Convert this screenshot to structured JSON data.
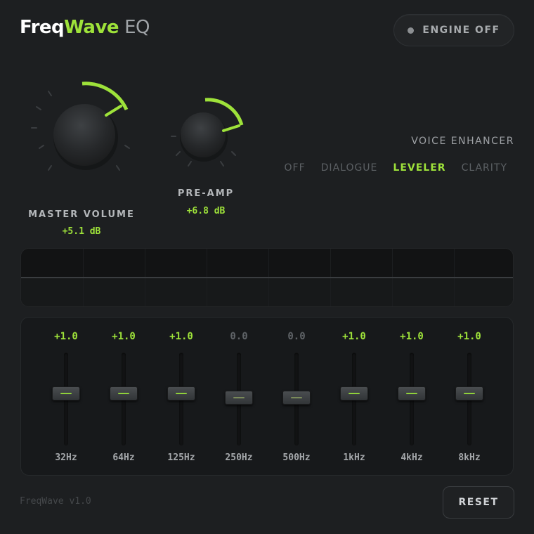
{
  "header": {
    "brand_part1": "Freq",
    "brand_part2": "Wave",
    "brand_suffix": "EQ",
    "engine_button": "ENGINE OFF",
    "engine_status_color": "#8c8f92"
  },
  "knobs": {
    "master": {
      "label": "MASTER VOLUME",
      "value": "+5.1 dB"
    },
    "preamp": {
      "label": "PRE-AMP",
      "value": "+6.8 dB"
    }
  },
  "voice_enhancer": {
    "title": "VOICE ENHANCER",
    "options": [
      "OFF",
      "DIALOGUE",
      "LEVELER",
      "CLARITY"
    ],
    "selected": "LEVELER"
  },
  "equalizer": {
    "bands": [
      {
        "label": "32Hz",
        "value": "+1.0"
      },
      {
        "label": "64Hz",
        "value": "+1.0"
      },
      {
        "label": "125Hz",
        "value": "+1.0"
      },
      {
        "label": "250Hz",
        "value": "0.0"
      },
      {
        "label": "500Hz",
        "value": "0.0"
      },
      {
        "label": "1kHz",
        "value": "+1.0"
      },
      {
        "label": "4kHz",
        "value": "+1.0"
      },
      {
        "label": "8kHz",
        "value": "+1.0"
      }
    ]
  },
  "footer": {
    "version": "FreqWave v1.0",
    "reset_button": "RESET"
  },
  "colors": {
    "accent": "#9ee23a",
    "background": "#1d1f21",
    "panel": "#17191b"
  },
  "icons": {
    "engine_status": "status-dot-icon"
  }
}
